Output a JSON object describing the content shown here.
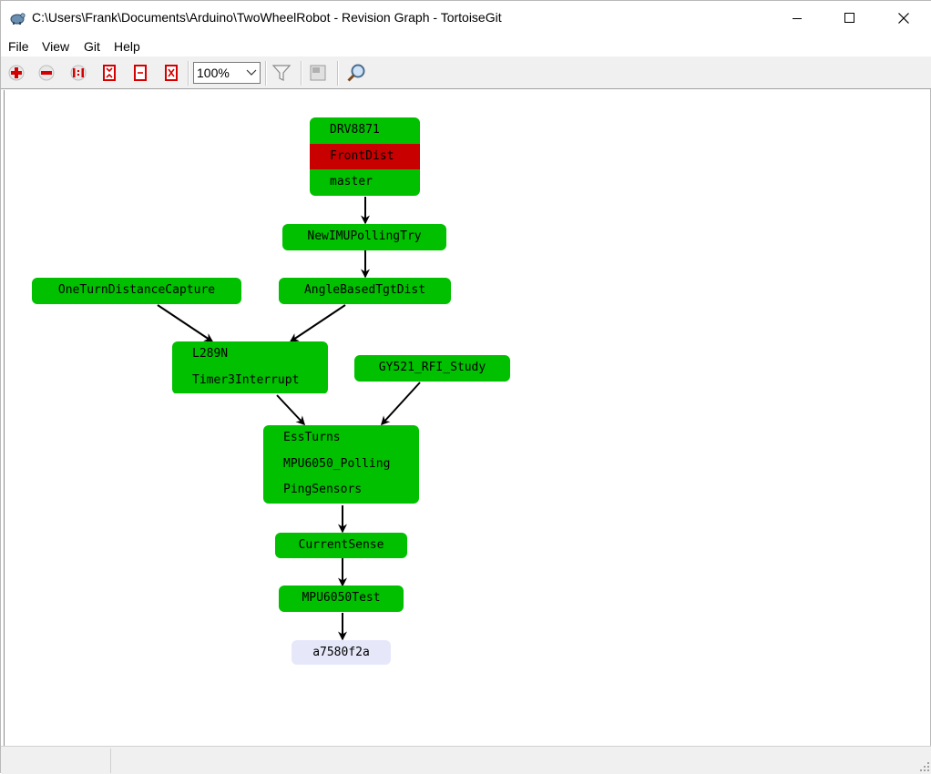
{
  "window": {
    "title": "C:\\Users\\Frank\\Documents\\Arduino\\TwoWheelRobot - Revision Graph - TortoiseGit"
  },
  "menu": [
    {
      "label": "File"
    },
    {
      "label": "View"
    },
    {
      "label": "Git"
    },
    {
      "label": "Help"
    }
  ],
  "toolbar": {
    "zoom_value": "100%",
    "buttons": [
      "zoom-in-icon",
      "zoom-out-icon",
      "zoom-1to1-icon",
      "fit-window-icon",
      "fit-height-icon",
      "fit-width-icon",
      "filter-icon",
      "overview-icon",
      "search-icon"
    ]
  },
  "graph": {
    "nodes": [
      {
        "id": "n1",
        "labels": [
          "DRV8871",
          "FrontDist",
          "master"
        ],
        "highlight": [
          false,
          true,
          false
        ]
      },
      {
        "id": "n2",
        "labels": [
          "NewIMUPollingTry"
        ]
      },
      {
        "id": "n3",
        "labels": [
          "AngleBasedTgtDist"
        ]
      },
      {
        "id": "n4",
        "labels": [
          "OneTurnDistanceCapture"
        ]
      },
      {
        "id": "n5",
        "labels": [
          "L289N",
          "Timer3Interrupt"
        ]
      },
      {
        "id": "n6",
        "labels": [
          "GY521_RFI_Study"
        ]
      },
      {
        "id": "n7",
        "labels": [
          "EssTurns",
          "MPU6050_Polling",
          "PingSensors"
        ]
      },
      {
        "id": "n8",
        "labels": [
          "CurrentSense"
        ]
      },
      {
        "id": "n9",
        "labels": [
          "MPU6050Test"
        ]
      },
      {
        "id": "n10",
        "labels": [
          "a7580f2a"
        ],
        "kind": "hash"
      }
    ]
  },
  "colors": {
    "branch_node": "#00c000",
    "current_branch": "#c80000",
    "commit_hash_node": "#e6e8fa",
    "edge": "#000000"
  }
}
